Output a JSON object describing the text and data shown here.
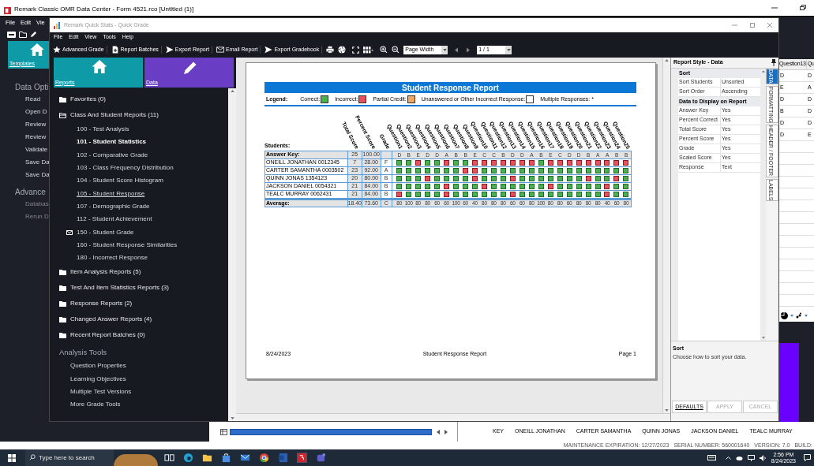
{
  "outer_window": {
    "title": "Remark Classic OMR Data Center - Form 4521.rco [Untitled (1)]",
    "menu": [
      "File",
      "Edit",
      "Vie"
    ],
    "tile": {
      "label": "Templates"
    },
    "sections": [
      {
        "heading": "Data Opti",
        "items": [
          {
            "label": "Read",
            "disabled": false
          },
          {
            "label": "Open D",
            "disabled": false
          },
          {
            "label": "Review",
            "disabled": false
          },
          {
            "label": "Review",
            "disabled": false
          },
          {
            "label": "Validate",
            "disabled": false
          },
          {
            "label": "Save Da",
            "disabled": false
          },
          {
            "label": "Save Da",
            "disabled": false
          }
        ]
      },
      {
        "heading": "Advance",
        "items": [
          {
            "label": "Databas",
            "disabled": true
          },
          {
            "label": "Rerun D",
            "disabled": true
          }
        ]
      }
    ],
    "grid": {
      "columns": [
        "Question13",
        "Qu"
      ],
      "rows": [
        [
          "D",
          "D"
        ],
        [
          "E",
          "A"
        ],
        [
          "D",
          "D"
        ],
        [
          "B",
          "D"
        ],
        [
          "D",
          "D"
        ],
        [
          "D",
          "E"
        ]
      ]
    },
    "student_strip": [
      "KEY",
      "ONEILL JONATHAN",
      "CARTER SAMANTHA",
      "QUINN JONAS",
      "JACKSON DANIEL",
      "TEALC MURRAY"
    ]
  },
  "quick_stats": {
    "title": "Remark Quick Stats - Quick Grade",
    "menu": [
      "File",
      "Edit",
      "View",
      "Tools",
      "Help"
    ],
    "toolbar": [
      "Advanced Grade",
      "Report Batches",
      "Export Report",
      "Email Report",
      "Export Gradebook"
    ],
    "zoom_select": {
      "value": "Page Width"
    },
    "page_select": {
      "value": "1 / 1"
    },
    "tiles": [
      {
        "label": "Reports",
        "color": "#0e9aa7"
      },
      {
        "label": "Data",
        "color": "#6a3ec4"
      }
    ],
    "tree": [
      {
        "label": "Favorites (0)",
        "expanded": false
      },
      {
        "label": "Class And Student Reports (11)",
        "expanded": true,
        "children": [
          {
            "label": "100 - Test Analysis",
            "kind": "report",
            "selected": false,
            "hovered": false
          },
          {
            "label": "101 - Student Statistics",
            "kind": "report",
            "selected": true,
            "hovered": false
          },
          {
            "label": "102 - Comparative Grade",
            "kind": "report",
            "selected": false,
            "hovered": false
          },
          {
            "label": "103 - Class Frequency Distribution",
            "kind": "report",
            "selected": false,
            "hovered": false
          },
          {
            "label": "104 - Student Score Histogram",
            "kind": "report",
            "selected": false,
            "hovered": false
          },
          {
            "label": "105 - Student Response",
            "kind": "report",
            "selected": false,
            "hovered": true
          },
          {
            "label": "107 - Demographic Grade",
            "kind": "report",
            "selected": false,
            "hovered": false
          },
          {
            "label": "112 - Student Achievement",
            "kind": "report",
            "selected": false,
            "hovered": false
          },
          {
            "label": "150 - Student Grade",
            "kind": "emailed",
            "selected": false,
            "hovered": false
          },
          {
            "label": "160 - Student Response Similarities",
            "kind": "report",
            "selected": false,
            "hovered": false
          },
          {
            "label": "180 - Incorrect Response",
            "kind": "report",
            "selected": false,
            "hovered": false
          }
        ]
      },
      {
        "label": "Item Analysis Reports (5)",
        "expanded": false
      },
      {
        "label": "Test And Item Statistics Reports (3)",
        "expanded": false
      },
      {
        "label": "Response Reports (2)",
        "expanded": false
      },
      {
        "label": "Changed Answer Reports (4)",
        "expanded": false
      },
      {
        "label": "Recent Report Batches (0)",
        "expanded": false
      }
    ],
    "analysis_tools": {
      "heading": "Analysis Tools",
      "items": [
        "Question Properties",
        "Learning Objectives",
        "Multiple Test Versions",
        "More Grade Tools"
      ]
    },
    "report": {
      "title": "Student Response Report",
      "legend": {
        "label": "Legend:",
        "items": [
          {
            "label": "Correct:",
            "color": "#4caf50"
          },
          {
            "label": "Incorrect:",
            "color": "#e8505b"
          },
          {
            "label": "Partial Credit:",
            "color": "#f0a860"
          },
          {
            "label": "Unanswered or Other Incorrect Response:",
            "color": "#ffffff"
          },
          {
            "label": "Multiple Responses: *"
          }
        ]
      },
      "students_label": "Students:",
      "columns": [
        "Total Score",
        "Percent Score",
        "Grade"
      ],
      "questions": [
        "Question1",
        "Question2",
        "Question3",
        "Question4",
        "Question5",
        "Question6",
        "Question7",
        "Question8",
        "Question9",
        "Question10",
        "Question11",
        "Question12",
        "Question13",
        "Question14",
        "Question15",
        "Question16",
        "Question17",
        "Question18",
        "Question19",
        "Question20",
        "Question21",
        "Question22",
        "Question23",
        "Question24",
        "Question25"
      ],
      "rows": [
        {
          "kind": "key",
          "name": "Answer Key:",
          "total": "25",
          "percent": "100.00",
          "cells": [
            "D",
            "B",
            "E",
            "D",
            "D",
            "A",
            "B",
            "B",
            "E",
            "C",
            "C",
            "B",
            "D",
            "D",
            "A",
            "B",
            "E",
            "C",
            "D",
            "D",
            "B",
            "A",
            "A",
            "B",
            "B"
          ]
        },
        {
          "kind": "student",
          "name": "ONEILL JONATHAN 0012345",
          "total": "7",
          "percent": "28.00",
          "grade": "F",
          "correct": [
            true,
            true,
            false,
            true,
            true,
            false,
            true,
            true,
            false,
            false,
            false,
            false,
            false,
            false,
            false,
            true,
            false,
            false,
            false,
            false,
            false,
            false,
            false,
            false,
            false
          ]
        },
        {
          "kind": "student",
          "name": "CARTER SAMANTHA 0003502",
          "total": "23",
          "percent": "92.00",
          "grade": "A",
          "correct": [
            true,
            true,
            true,
            true,
            true,
            true,
            true,
            false,
            false,
            true,
            true,
            true,
            true,
            true,
            true,
            true,
            true,
            true,
            true,
            true,
            true,
            true,
            true,
            true,
            true
          ]
        },
        {
          "kind": "student",
          "name": "QUINN JONAS 1354123",
          "total": "20",
          "percent": "80.00",
          "grade": "B",
          "correct": [
            true,
            true,
            true,
            false,
            true,
            true,
            true,
            true,
            false,
            true,
            true,
            true,
            false,
            true,
            true,
            true,
            true,
            true,
            true,
            true,
            false,
            true,
            true,
            false,
            true
          ]
        },
        {
          "kind": "student",
          "name": "JACKSON DANIEL 0054321",
          "total": "21",
          "percent": "84.00",
          "grade": "B",
          "correct": [
            true,
            true,
            true,
            true,
            true,
            false,
            true,
            true,
            true,
            false,
            true,
            true,
            true,
            true,
            true,
            true,
            false,
            true,
            true,
            true,
            true,
            true,
            false,
            true,
            true
          ]
        },
        {
          "kind": "student",
          "name": "TEALC MURRAY 0062431",
          "total": "21",
          "percent": "84.00",
          "grade": "B",
          "correct": [
            false,
            true,
            true,
            true,
            true,
            false,
            true,
            true,
            true,
            true,
            true,
            true,
            false,
            true,
            true,
            true,
            true,
            true,
            true,
            true,
            true,
            true,
            false,
            true,
            true
          ]
        },
        {
          "kind": "average",
          "name": "Average:",
          "total": "18.40",
          "percent": "73.60",
          "grade": "C",
          "cells": [
            "80",
            "100",
            "80",
            "80",
            "60",
            "60",
            "100",
            "60",
            "40",
            "80",
            "80",
            "80",
            "60",
            "60",
            "80",
            "100",
            "80",
            "80",
            "60",
            "80",
            "80",
            "80",
            "40",
            "60",
            "80"
          ]
        }
      ],
      "footer": {
        "date": "8/24/2023",
        "title": "Student Response Report",
        "page": "Page 1"
      }
    },
    "style_panel": {
      "title": "Report Style - Data",
      "groups": [
        {
          "heading": "Sort",
          "rows": [
            {
              "name": "Sort Students",
              "value": "Unsorted"
            },
            {
              "name": "Sort Order",
              "value": "Ascending"
            }
          ]
        },
        {
          "heading": "Data to Display on Report",
          "rows": [
            {
              "name": "Answer Key",
              "value": "Yes"
            },
            {
              "name": "Percent Correct",
              "value": "Yes"
            },
            {
              "name": "Total Score",
              "value": "Yes"
            },
            {
              "name": "Percent Score",
              "value": "Yes"
            },
            {
              "name": "Grade",
              "value": "Yes"
            },
            {
              "name": "Scaled Score",
              "value": "Yes"
            },
            {
              "name": "Response",
              "value": "Text"
            }
          ]
        }
      ],
      "tabs": [
        {
          "label": "DATA",
          "selected": true
        },
        {
          "label": "FORMATTING",
          "selected": false
        },
        {
          "label": "HEADER / FOOTER",
          "selected": false
        },
        {
          "label": "LABELS",
          "selected": false
        }
      ],
      "description": {
        "title": "Sort",
        "text": "Choose how to sort your data."
      },
      "buttons": [
        {
          "label": "DEFAULTS",
          "disabled": false
        },
        {
          "label": "APPLY",
          "disabled": true
        },
        {
          "label": "CANCEL",
          "disabled": true
        }
      ]
    }
  },
  "status_bar": [
    "MAINTENANCE EXPIRATION: 12/27/2023",
    "SERIAL NUMBER: 560001640",
    "VERSION: 7.0",
    "BUILD:"
  ],
  "taskbar": {
    "search": {
      "placeholder": "Type here to search"
    },
    "time": "2:56 PM",
    "date": "8/24/2023"
  }
}
